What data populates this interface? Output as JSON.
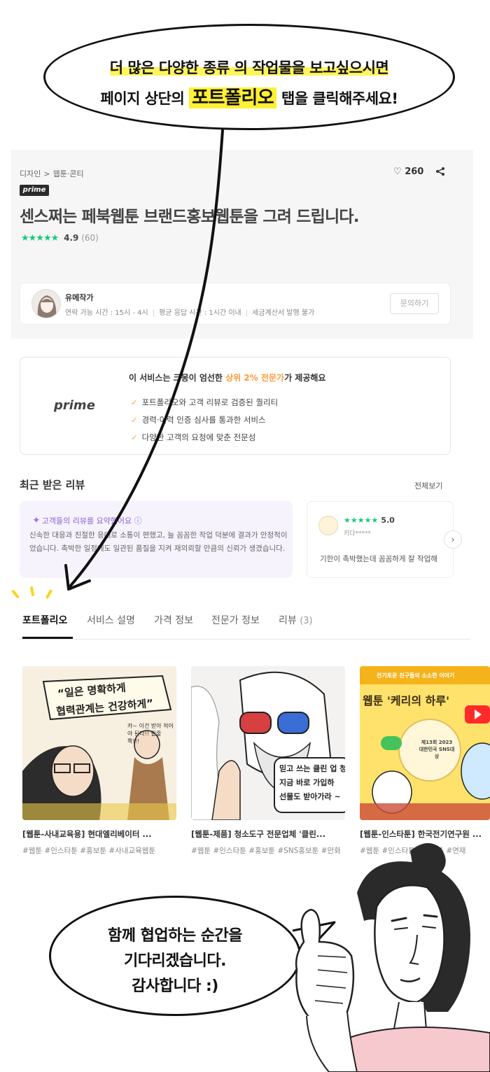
{
  "overlay_top": {
    "line1": "더 많은 다양한 종류 의 작업물을 보고싶으시면",
    "line2_pre": "페이지 상단의 ",
    "line2_highlight": "포트폴리오",
    "line2_post": " 탭을 클릭해주세요!"
  },
  "product": {
    "breadcrumb": [
      "디자인",
      "웹툰·콘티"
    ],
    "breadcrumb_sep": ">",
    "likes": "260",
    "prime_badge": "prime",
    "title": "센스쩌는 페북웹툰 브랜드홍보웹툰을 그려 드립니다.",
    "stars": "★★★★★",
    "rating": "4.9",
    "review_count": "(60)"
  },
  "seller": {
    "name": "유메작가",
    "contact_hours": "연락 가능 시간 : 15시 - 4시",
    "response_time": "평균 응답 시간 : 1시간 이내",
    "tax_invoice": "세금계산서 발행 불가",
    "ask_button": "문의하기"
  },
  "prime": {
    "logo": "prime",
    "heading_pre": "이 서비스는 크몽이 엄선한 ",
    "heading_accent": "상위 2% 전문가",
    "heading_post": "가 제공해요",
    "items": [
      "포트폴리오와 고객 리뷰로 검증된 퀄리티",
      "경력·이력 인증 심사를 통과한 서비스",
      "다양한 고객의 요청에 맞춘 전문성"
    ]
  },
  "reviews": {
    "title": "최근 받은 리뷰",
    "see_all": "전체보기",
    "ai_title": "고객들의 리뷰를 요약했어요",
    "ai_body": "신속한 대응과 친절한 응대로 소통이 편했고, 늘 꼼꼼한 작업 덕분에 결과가 안정적이었습니다. 촉박한 일정에도 일관된 품질을 지켜 재의뢰할 만큼의 신뢰가 생겼습니다.",
    "card2_stars": "★★★★★",
    "card2_score": "5.0",
    "card2_user": "키다*****",
    "card2_text": "기한이 촉박했는데 꼼꼼하게 잘 작업해"
  },
  "tabs": [
    {
      "label": "포트폴리오",
      "count": ""
    },
    {
      "label": "서비스 설명",
      "count": ""
    },
    {
      "label": "가격 정보",
      "count": ""
    },
    {
      "label": "전문가 정보",
      "count": ""
    },
    {
      "label": "리뷰",
      "count": "(3)"
    }
  ],
  "portfolio": [
    {
      "title": "[웹툰-사내교육용] 현대엘리베이터 ...",
      "tags": "#웹툰 #인스타툰 #홍보툰 #사내교육웹툰",
      "art_text1": "“일은 명확하게",
      "art_text2": "협력관계는 건강하게”",
      "art_text3": "캬~ 이건 받아 적어야 된다!! 밑줄 쫙!!!"
    },
    {
      "title": "[웹툰-제품] 청소도구 전문업체 '클린...",
      "tags": "#웹툰 #인스타툰 #홍보툰 #SNS홍보툰 #만화",
      "art_text1": "믿고 쓰는 클린 업 청",
      "art_text2": "지금 바로 가입하",
      "art_text3": "선물도 받아가라 ~"
    },
    {
      "title": "[웹툰-인스타툰] 한국전기연구원 ...",
      "tags": "#웹툰 #인스타툰 #홍보툰 #연재",
      "art_text1": "전기토운 친구들의 소소한 이야기",
      "art_text2": "웹툰 '케리의 하루'",
      "art_text3": "제13회 2023 대한민국 SNS대상"
    }
  ],
  "overlay_bottom": {
    "line1": "함께 협업하는 순간을",
    "line2": "기다리겠습니다.",
    "line3": "감사합니다 :)"
  }
}
